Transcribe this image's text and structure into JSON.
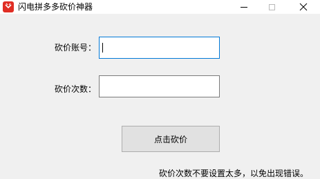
{
  "window": {
    "title": "闪电拼多多砍价神器",
    "brand_color": "#e02e24"
  },
  "form": {
    "account_label": "砍价账号：",
    "account_value": "",
    "count_label": "砍价次数：",
    "count_value": ""
  },
  "action": {
    "button_label": "点击砍价"
  },
  "footer": {
    "note": "砍价次数不要设置太多，以免出现错误。"
  }
}
